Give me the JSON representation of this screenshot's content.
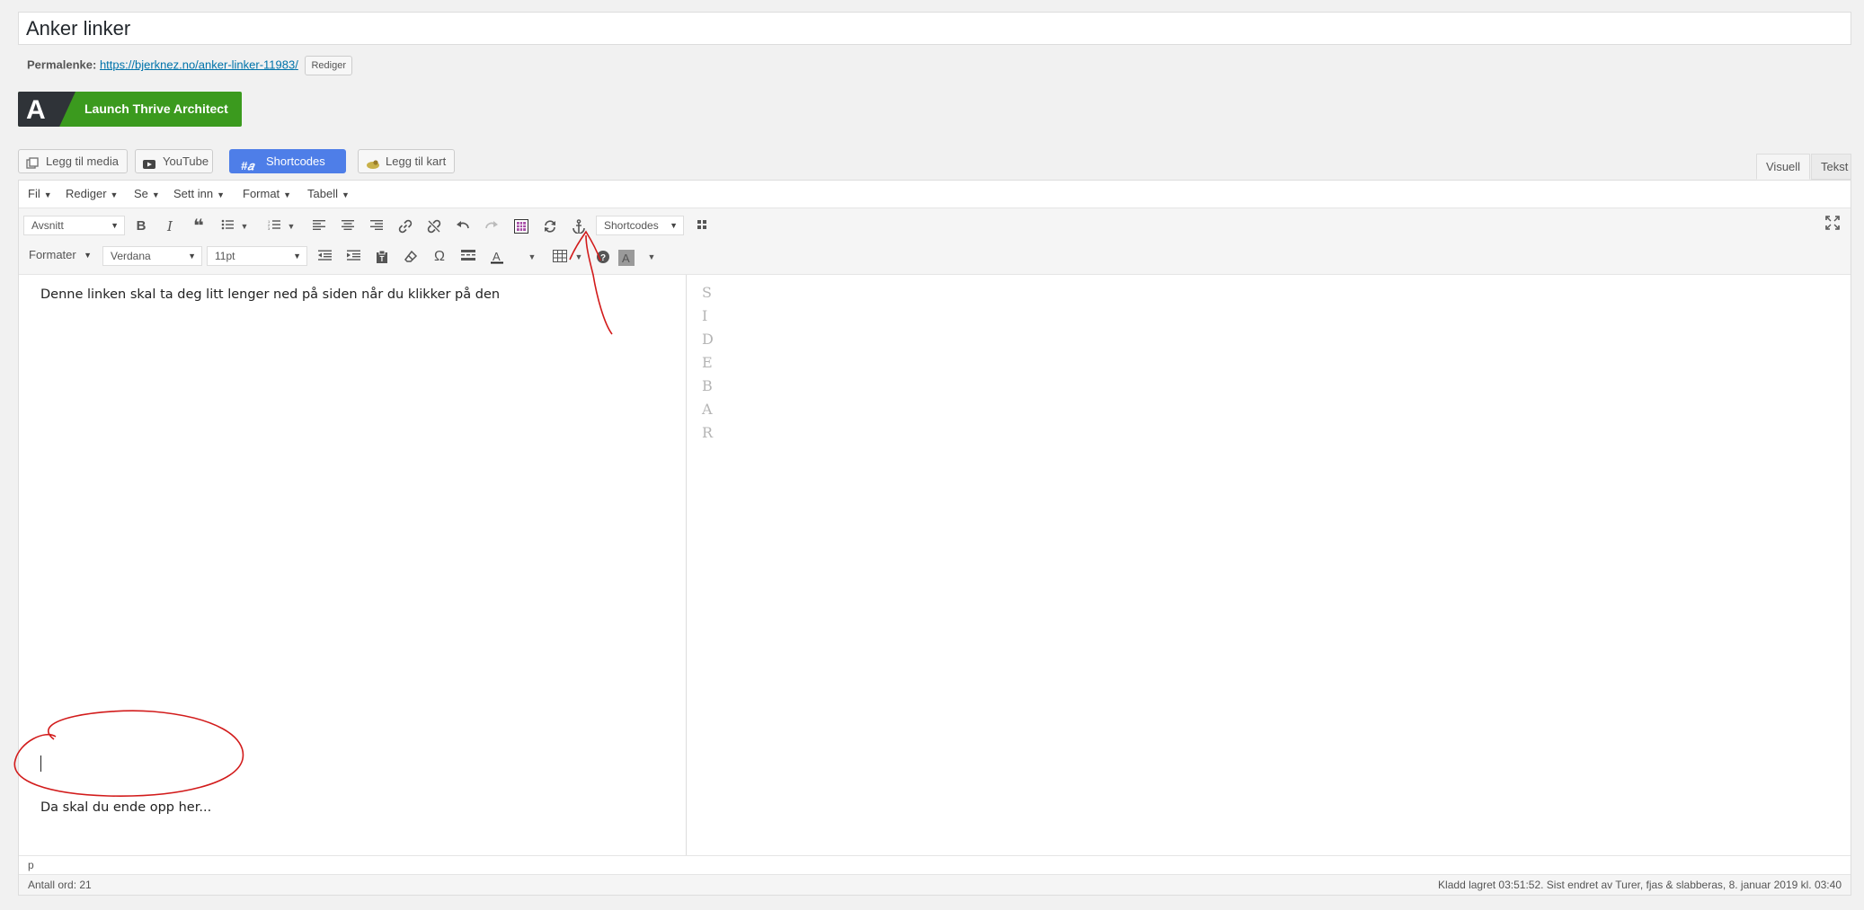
{
  "post": {
    "title": "Anker linker",
    "permalink_label": "Permalenke:",
    "permalink_base": "https://bjerknez.no/",
    "permalink_slug": "anker-linker-11983",
    "permalink_tail": "/",
    "edit_slug_label": "Rediger"
  },
  "thrive": {
    "label": "Launch Thrive Architect",
    "logo_letter": "A"
  },
  "media_buttons": [
    {
      "label": "Legg til media",
      "icon": "media-icon"
    },
    {
      "label": "YouTube",
      "icon": "youtube-icon"
    },
    {
      "label": "Shortcodes",
      "icon": "shortcodes-icon"
    },
    {
      "label": "Legg til kart",
      "icon": "map-icon"
    }
  ],
  "tabs": {
    "visual": "Visuell",
    "text": "Tekst"
  },
  "menubar": [
    "Fil",
    "Rediger",
    "Se",
    "Sett inn",
    "Format",
    "Tabell"
  ],
  "toolbar": {
    "paragraph_select": "Avsnitt",
    "shortcodes_select": "Shortcodes",
    "formats_select": "Formater",
    "font_select": "Verdana",
    "size_select": "11pt"
  },
  "content": {
    "line1": "Denne linken skal ta deg litt lenger ned på siden når du klikker på den",
    "line2": "Da skal du ende opp her..."
  },
  "sidebar_letters": [
    "S",
    "I",
    "D",
    "E",
    "B",
    "A",
    "R"
  ],
  "statusbar": {
    "path": "p"
  },
  "footer": {
    "word_count": "Antall ord: 21",
    "saved": "Kladd lagret 03:51:52. Sist endret av Turer, fjas & slabberas, 8. januar 2019 kl. 03:40"
  },
  "colors": {
    "thrive_green": "#3b9a1e",
    "shortcodes_blue": "#4e7ee8",
    "annotation_red": "#d21b1b",
    "link": "#0073aa"
  }
}
